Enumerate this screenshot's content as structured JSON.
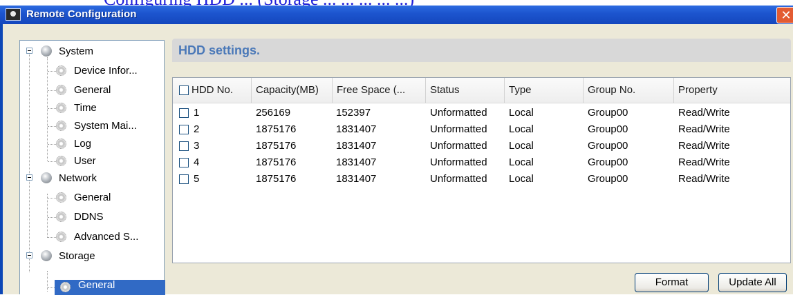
{
  "top_strip_text": "Configuring HDD ... (Storage ... ... ... ... ...)",
  "window": {
    "title": "Remote Configuration",
    "close_label": "✕"
  },
  "tree": {
    "groups": [
      {
        "label": "System",
        "items": [
          "Device Infor...",
          "General",
          "Time",
          "System Mai...",
          "Log",
          "User"
        ]
      },
      {
        "label": "Network",
        "items": [
          "General",
          "DDNS",
          "Advanced S..."
        ]
      },
      {
        "label": "Storage",
        "items": [
          "General"
        ],
        "selected": "General"
      }
    ]
  },
  "panel": {
    "title": "HDD settings.",
    "columns": [
      "HDD No.",
      "Capacity(MB)",
      "Free Space (...",
      "Status",
      "Type",
      "Group No.",
      "Property"
    ],
    "rows": [
      {
        "hdd": "1",
        "capacity": "256169",
        "free": "152397",
        "status": "Unformatted",
        "type": "Local",
        "group": "Group00",
        "property": "Read/Write"
      },
      {
        "hdd": "2",
        "capacity": "1875176",
        "free": "1831407",
        "status": "Unformatted",
        "type": "Local",
        "group": "Group00",
        "property": "Read/Write"
      },
      {
        "hdd": "3",
        "capacity": "1875176",
        "free": "1831407",
        "status": "Unformatted",
        "type": "Local",
        "group": "Group00",
        "property": "Read/Write"
      },
      {
        "hdd": "4",
        "capacity": "1875176",
        "free": "1831407",
        "status": "Unformatted",
        "type": "Local",
        "group": "Group00",
        "property": "Read/Write"
      },
      {
        "hdd": "5",
        "capacity": "1875176",
        "free": "1831407",
        "status": "Unformatted",
        "type": "Local",
        "group": "Group00",
        "property": "Read/Write"
      }
    ]
  },
  "buttons": {
    "format": "Format",
    "update_all": "Update All"
  },
  "colors": {
    "title_bar": "#1d55cf",
    "selection": "#316ac5",
    "header_text": "#4a78b8"
  }
}
